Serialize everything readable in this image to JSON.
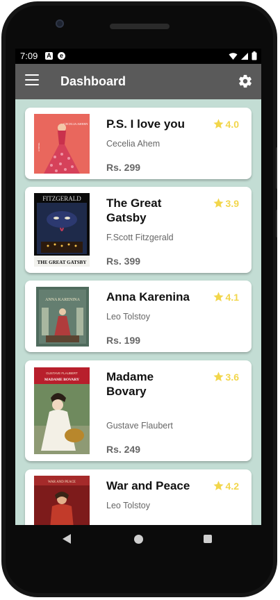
{
  "status": {
    "time": "7:09",
    "icon_a": "A",
    "icon_b": "e"
  },
  "appbar": {
    "title": "Dashboard",
    "menu_icon": "hamburger-icon",
    "settings_icon": "gear-icon"
  },
  "books": [
    {
      "title": "P.S. I love you",
      "author": "Cecelia Ahem",
      "price": "Rs. 299",
      "rating": "4.0",
      "cover_text": "CECELIA AHERN",
      "cover_sub": "A NOVEL"
    },
    {
      "title": "The Great Gatsby",
      "author": "F.Scott Fitzgerald",
      "price": "Rs. 399",
      "rating": "3.9",
      "cover_text": "FITZGERALD",
      "cover_sub": "THE GREAT GATSBY"
    },
    {
      "title": "Anna Karenina",
      "author": "Leo Tolstoy",
      "price": "Rs. 199",
      "rating": "4.1",
      "cover_text": "ANNA KARENINA",
      "cover_sub": ""
    },
    {
      "title": "Madame Bovary",
      "author": "Gustave Flaubert",
      "price": "Rs. 249",
      "rating": "3.6",
      "cover_text": "GUSTAVE FLAUBERT",
      "cover_sub": "MADAME BOVARY"
    },
    {
      "title": "War and Peace",
      "author": "Leo Tolstoy",
      "price": "",
      "rating": "4.2",
      "cover_text": "WAR AND PEACE",
      "cover_sub": ""
    }
  ],
  "colors": {
    "appbar": "#5a5a5a",
    "background": "#c3ddd4",
    "star": "#f2d64b"
  }
}
